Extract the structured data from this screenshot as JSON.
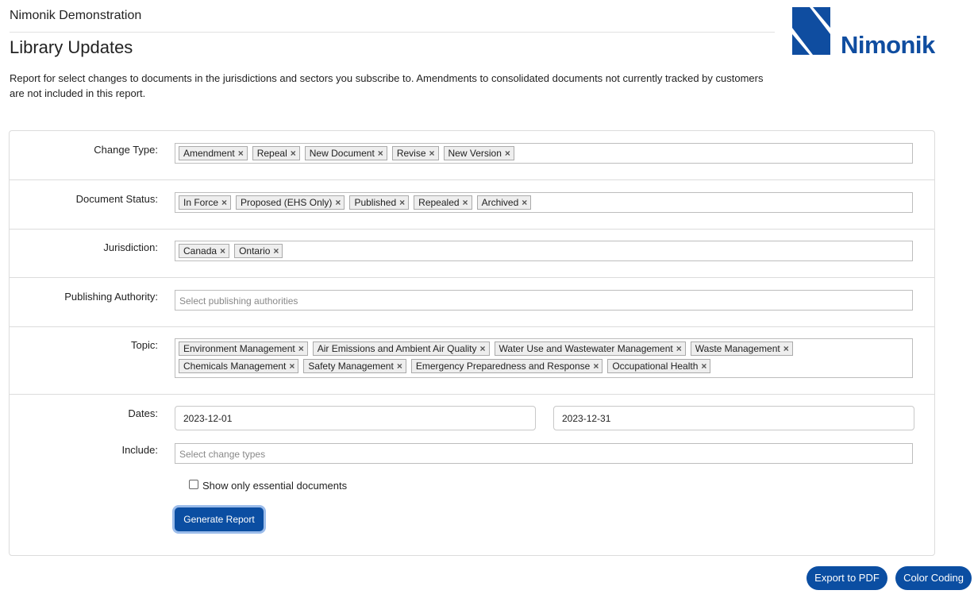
{
  "header": {
    "org_name": "Nimonik Demonstration",
    "title": "Library Updates",
    "description": "Report for select changes to documents in the jurisdictions and sectors you subscribe to. Amendments to consolidated documents not currently tracked by customers are not included in this report.",
    "logo_text": "Nimonik"
  },
  "brand": {
    "primary": "#0b4ea2",
    "logo": "#0f4da0"
  },
  "form": {
    "change_type": {
      "label": "Change Type:",
      "tags": [
        "Amendment",
        "Repeal",
        "New Document",
        "Revise",
        "New Version"
      ]
    },
    "document_status": {
      "label": "Document Status:",
      "tags": [
        "In Force",
        "Proposed (EHS Only)",
        "Published",
        "Repealed",
        "Archived"
      ]
    },
    "jurisdiction": {
      "label": "Jurisdiction:",
      "tags": [
        "Canada",
        "Ontario"
      ]
    },
    "publishing_authority": {
      "label": "Publishing Authority:",
      "placeholder": "Select publishing authorities"
    },
    "topic": {
      "label": "Topic:",
      "tags": [
        "Environment Management",
        "Air Emissions and Ambient Air Quality",
        "Water Use and Wastewater Management",
        "Waste Management",
        "Chemicals Management",
        "Safety Management",
        "Emergency Preparedness and Response",
        "Occupational Health"
      ]
    },
    "dates": {
      "label": "Dates:",
      "start": "2023-12-01",
      "end": "2023-12-31"
    },
    "include": {
      "label": "Include:",
      "placeholder": "Select change types"
    },
    "essential_only": {
      "label": "Show only essential documents",
      "checked": false
    },
    "generate_label": "Generate Report"
  },
  "actions": {
    "export_pdf": "Export to PDF",
    "color_coding": "Color Coding"
  },
  "icons": {
    "tag_remove": "×"
  }
}
